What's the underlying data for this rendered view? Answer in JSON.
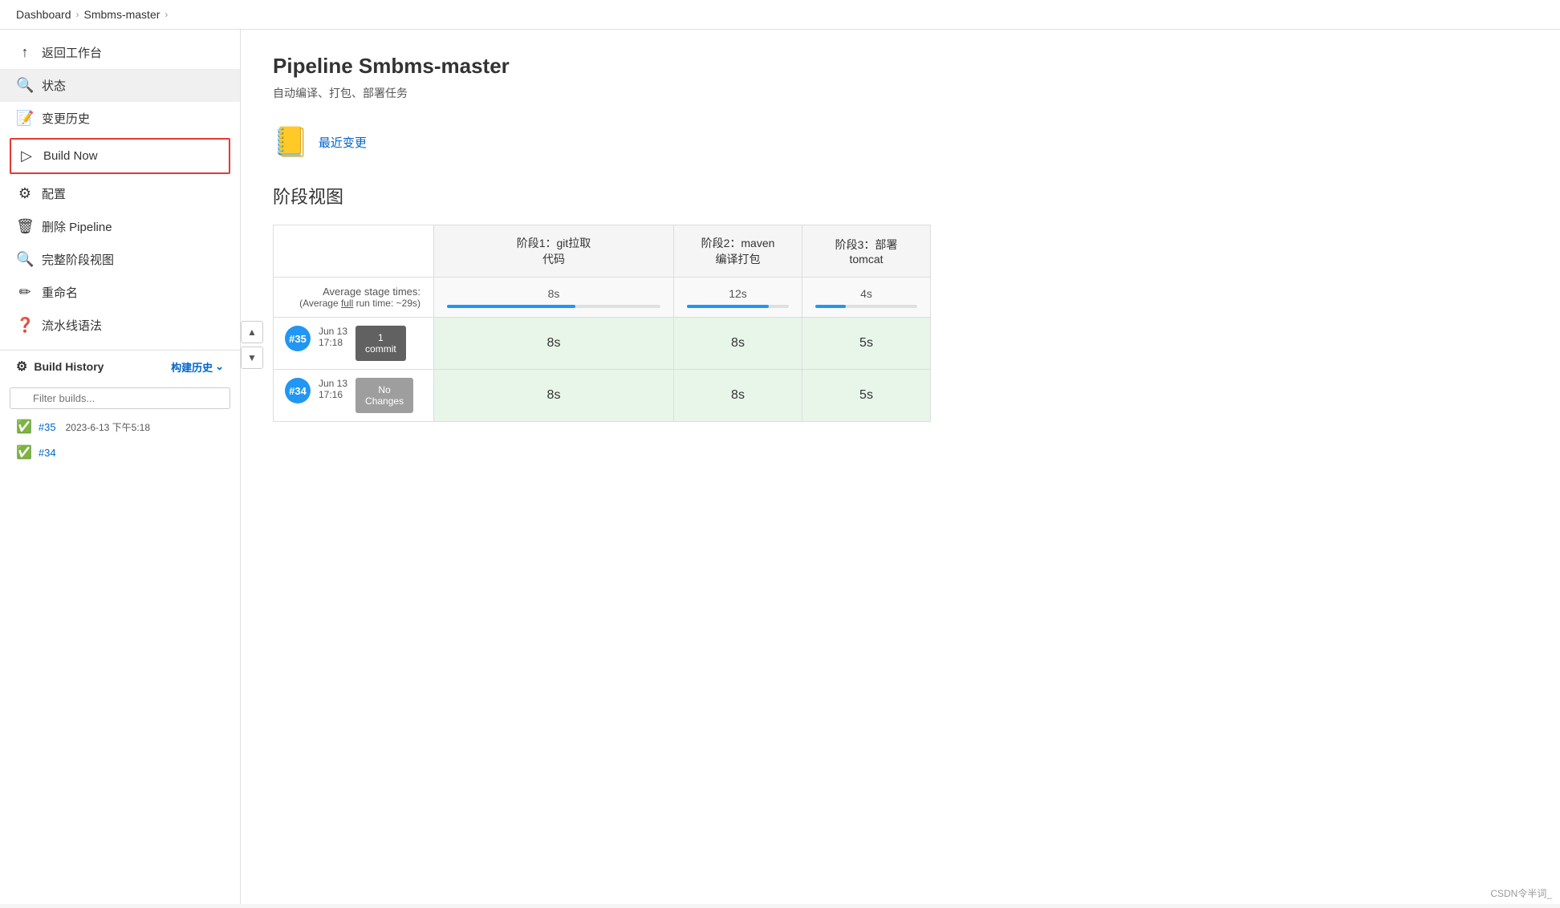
{
  "breadcrumb": {
    "items": [
      "Dashboard",
      "Smbms-master"
    ],
    "separators": [
      "›",
      "›"
    ]
  },
  "sidebar": {
    "items": [
      {
        "id": "return",
        "icon": "↑",
        "label": "返回工作台",
        "active": false
      },
      {
        "id": "status",
        "icon": "🔍",
        "label": "状态",
        "active": true
      },
      {
        "id": "changes",
        "icon": "📝",
        "label": "变更历史",
        "active": false
      },
      {
        "id": "build-now",
        "icon": "▷",
        "label": "Build Now",
        "active": false,
        "highlight": true
      },
      {
        "id": "config",
        "icon": "⚙",
        "label": "配置",
        "active": false
      },
      {
        "id": "delete",
        "icon": "🗑",
        "label": "删除 Pipeline",
        "active": false
      },
      {
        "id": "full-stage",
        "icon": "🔍",
        "label": "完整阶段视图",
        "active": false
      },
      {
        "id": "rename",
        "icon": "✏",
        "label": "重命名",
        "active": false
      },
      {
        "id": "syntax",
        "icon": "❓",
        "label": "流水线语法",
        "active": false
      }
    ],
    "build_history": {
      "title": "Build History",
      "link_label": "构建历史",
      "filter_placeholder": "Filter builds...",
      "builds": [
        {
          "id": "#35",
          "status": "ok",
          "date": "2023-6-13 下午5:18",
          "active": true
        },
        {
          "id": "#34",
          "status": "ok",
          "date": "",
          "active": false
        }
      ]
    }
  },
  "main": {
    "title": "Pipeline Smbms-master",
    "subtitle": "自动编译、打包、部署任务",
    "recent_changes_label": "最近变更",
    "section_title": "阶段视图",
    "stage_table": {
      "avg_label": "Average stage times:",
      "avg_full_label": "(Average full run time: ~29s)",
      "headers": [
        "阶段1：git拉取\n代码",
        "阶段2：maven\n编译打包",
        "阶段3：部署\ntomcat"
      ],
      "avg_times": [
        "8s",
        "12s",
        "4s"
      ],
      "avg_bar_widths": [
        60,
        80,
        30
      ],
      "builds": [
        {
          "num": "#35",
          "date": "Jun 13",
          "time": "17:18",
          "commit": "1\ncommit",
          "stages": [
            "8s",
            "8s",
            "5s"
          ]
        },
        {
          "num": "#34",
          "date": "Jun 13",
          "time": "17:16",
          "commit": "No\nChanges",
          "stages": [
            "8s",
            "8s",
            "5s"
          ]
        }
      ]
    }
  }
}
